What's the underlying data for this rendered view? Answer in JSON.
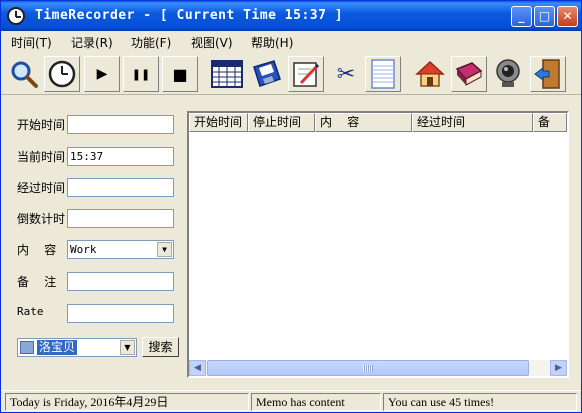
{
  "window": {
    "title": "TimeRecorder - [ Current Time 15:37 ]",
    "minimize_glyph": "_",
    "maximize_glyph": "□",
    "close_glyph": "✕"
  },
  "menu": [
    {
      "label": "时间(T)"
    },
    {
      "label": "记录(R)"
    },
    {
      "label": "功能(F)"
    },
    {
      "label": "视图(V)"
    },
    {
      "label": "帮助(H)"
    }
  ],
  "toolbar": [
    {
      "icon": "magnifier-icon"
    },
    {
      "icon": "clock-icon"
    },
    {
      "icon": "play-icon",
      "glyph": "▶"
    },
    {
      "icon": "pause-icon",
      "glyph": "❚❚"
    },
    {
      "icon": "stop-icon",
      "glyph": "■"
    },
    {
      "icon": "calendar-grid-icon"
    },
    {
      "icon": "floppy-disk-icon"
    },
    {
      "icon": "edit-note-icon"
    },
    {
      "icon": "scissors-icon",
      "glyph": "✂"
    },
    {
      "icon": "notepad-icon"
    },
    {
      "icon": "home-icon"
    },
    {
      "icon": "book-icon"
    },
    {
      "icon": "webcam-icon"
    },
    {
      "icon": "exit-door-icon"
    }
  ],
  "form": {
    "start_time": {
      "label": "开始时间",
      "value": ""
    },
    "current_time": {
      "label": "当前时间",
      "value": "15:37"
    },
    "elapsed_time": {
      "label": "经过时间",
      "value": ""
    },
    "countdown": {
      "label": "倒数计时",
      "value": ""
    },
    "content": {
      "label": "内    容",
      "value": "Work"
    },
    "memo": {
      "label": "备    注",
      "value": ""
    },
    "rate": {
      "label": "Rate",
      "value": ""
    }
  },
  "search": {
    "value": "洛宝贝",
    "button_label": "搜索"
  },
  "list": {
    "columns": [
      "开始时间",
      "停止时间",
      "内    容",
      "经过时间",
      "备"
    ],
    "rows": []
  },
  "status": {
    "date_text": "Today is Friday, 2016年4月29日",
    "memo_text": "Memo has content",
    "uses_text": "You can use 45 times!"
  },
  "colors": {
    "titlebar": "#0450d6",
    "face": "#ece9d8",
    "selection": "#316ac5"
  }
}
